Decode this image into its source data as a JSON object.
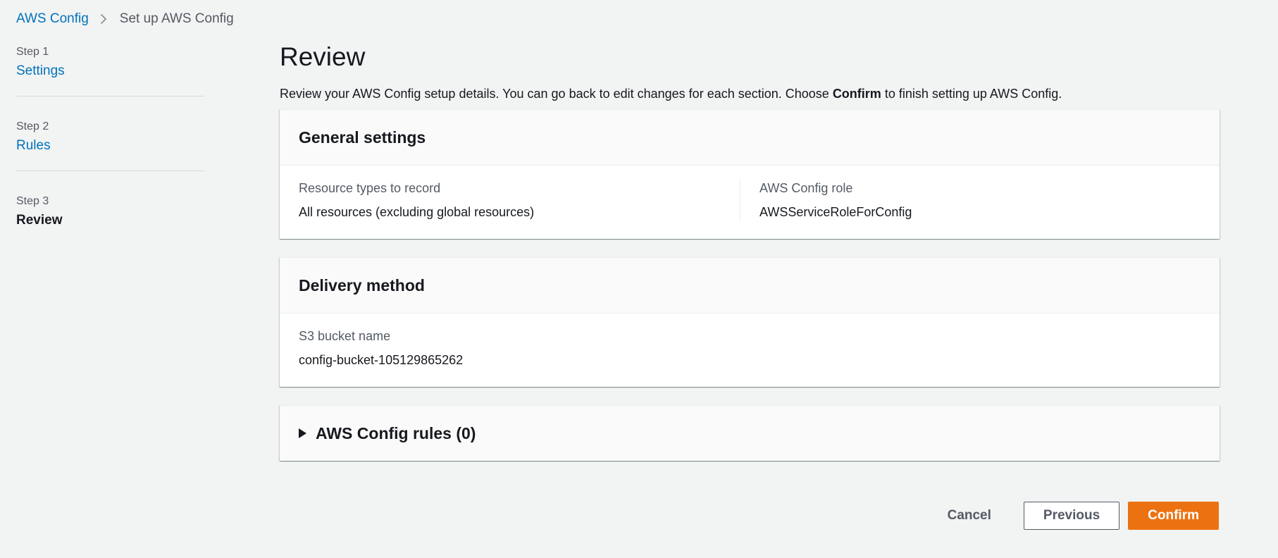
{
  "breadcrumb": {
    "root": "AWS Config",
    "current": "Set up AWS Config"
  },
  "steps": [
    {
      "num": "Step 1",
      "label": "Settings"
    },
    {
      "num": "Step 2",
      "label": "Rules"
    },
    {
      "num": "Step 3",
      "label": "Review"
    }
  ],
  "page": {
    "title": "Review",
    "desc_before": "Review your AWS Config setup details. You can go back to edit changes for each section. Choose ",
    "desc_bold": "Confirm",
    "desc_after": " to finish setting up AWS Config."
  },
  "general": {
    "title": "General settings",
    "resource_label": "Resource types to record",
    "resource_value": "All resources (excluding global resources)",
    "role_label": "AWS Config role",
    "role_value": "AWSServiceRoleForConfig"
  },
  "delivery": {
    "title": "Delivery method",
    "bucket_label": "S3 bucket name",
    "bucket_value": "config-bucket-105129865262"
  },
  "rules": {
    "title": "AWS Config rules (0)"
  },
  "actions": {
    "cancel": "Cancel",
    "previous": "Previous",
    "confirm": "Confirm"
  },
  "colors": {
    "link": "#0073bb",
    "primary": "#ec7211",
    "background": "#f2f3f3"
  }
}
